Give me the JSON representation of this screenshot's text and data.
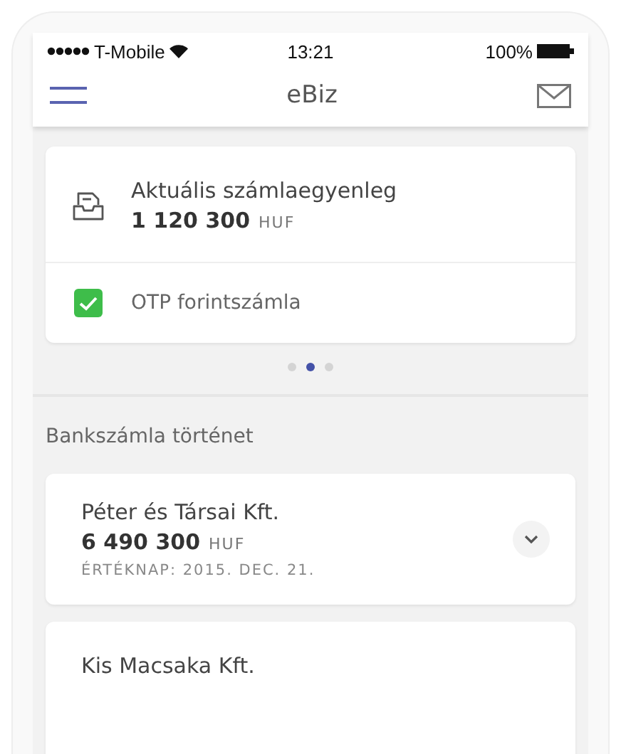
{
  "status_bar": {
    "carrier": "T-Mobile",
    "time": "13:21",
    "battery": "100%"
  },
  "nav_bar": {
    "title": "eBiz"
  },
  "balance_card": {
    "label": "Aktuális számlaegyenleg",
    "amount": "1 120 300",
    "currency": "HUF",
    "account": {
      "name": "OTP forintszámla",
      "checked": true
    }
  },
  "pager": [
    {
      "selected": false
    },
    {
      "selected": true
    },
    {
      "selected": false
    }
  ],
  "history": {
    "title": "Bankszámla történet",
    "items": [
      {
        "name": "Péter és Társai Kft.",
        "amount": "6 490 300",
        "currency": "HUF",
        "value_date": "ÉRTÉKNAP: 2015. DEC. 21."
      },
      {
        "name": "Kis Macsaka Kft."
      }
    ]
  }
}
